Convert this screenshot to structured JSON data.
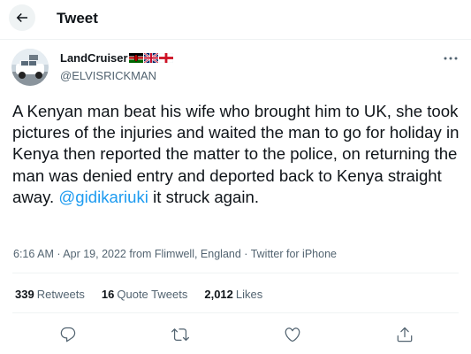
{
  "header": {
    "title": "Tweet",
    "back_icon": "arrow-left-icon"
  },
  "author": {
    "name": "LandCruiser",
    "handle": "@ELVISRICKMAN",
    "flags": [
      "kenya-flag-icon",
      "uk-flag-icon",
      "england-flag-icon"
    ]
  },
  "tweet": {
    "text": "A Kenyan man beat his wife who brought him to UK, she took pictures of the injuries and waited the man to go for holiday in Kenya then reported the matter to the police, on returning the man was denied entry and deported back to Kenya straight away.",
    "mention": "@gidikariuki",
    "text_after": " it struck again."
  },
  "meta": {
    "time": "6:16 AM",
    "date": "Apr 19, 2022",
    "location": "from Flimwell, England",
    "source": "Twitter for iPhone"
  },
  "stats": [
    {
      "count": "339",
      "label": "Retweets"
    },
    {
      "count": "16",
      "label": "Quote Tweets"
    },
    {
      "count": "2,012",
      "label": "Likes"
    }
  ],
  "actions": [
    "reply-icon",
    "retweet-icon",
    "like-icon",
    "share-icon"
  ],
  "colors": {
    "accent": "#1d9bf0",
    "text": "#0f1419",
    "secondary": "#536471",
    "border": "#eff3f4"
  }
}
